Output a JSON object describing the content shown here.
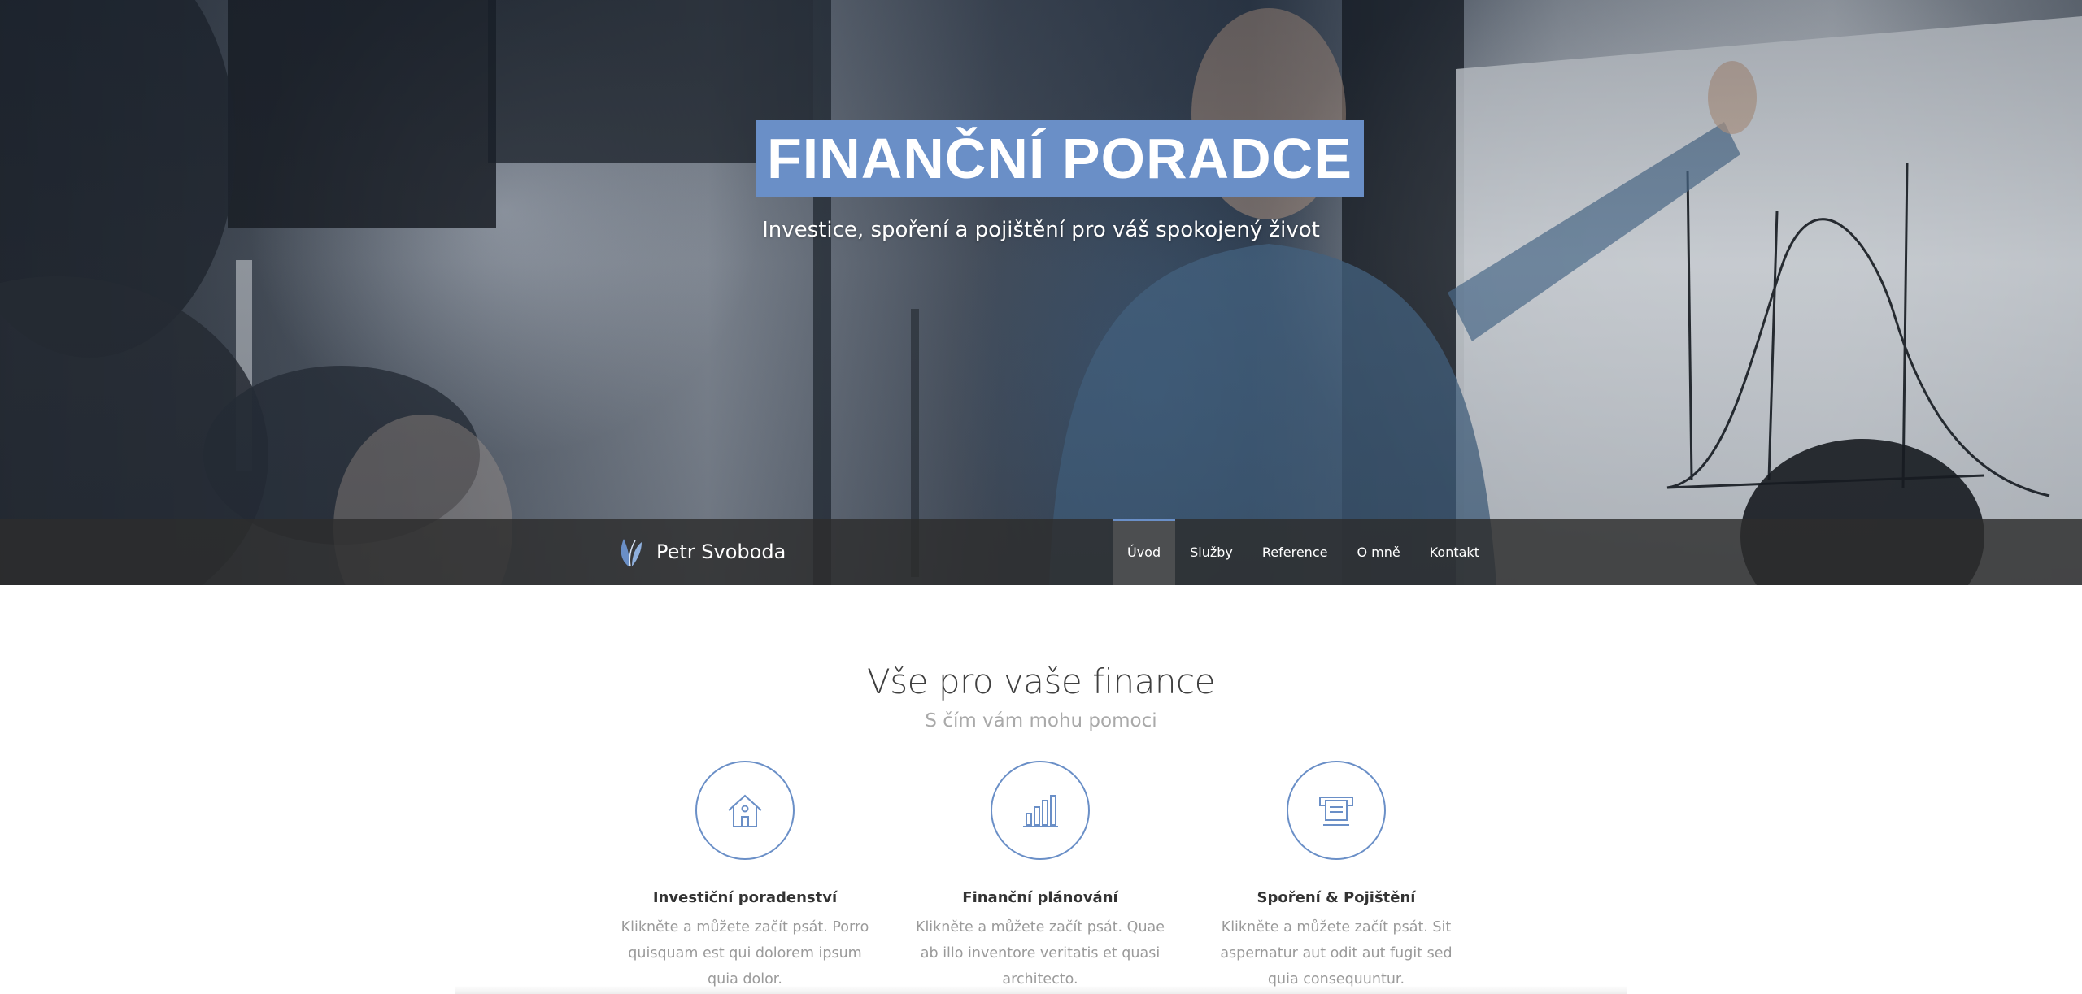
{
  "hero": {
    "title": "FINANČNÍ PORADCE",
    "subtitle": "Investice, spoření a pojištění pro váš spokojený život",
    "title_bg_color": "#6a8fc7"
  },
  "navbar": {
    "brand_name": "Petr Svoboda",
    "logo_icon": "leaf-logo-icon",
    "items": [
      {
        "label": "Úvod",
        "active": true
      },
      {
        "label": "Služby",
        "active": false
      },
      {
        "label": "Reference",
        "active": false
      },
      {
        "label": "O mně",
        "active": false
      },
      {
        "label": "Kontakt",
        "active": false
      }
    ]
  },
  "services": {
    "title": "Vše pro vaše finance",
    "subtitle": "S čím vám mohu pomoci",
    "accent_color": "#6a8fc7",
    "features": [
      {
        "icon": "house-icon",
        "title": "Investiční poradenství",
        "text": "Klikněte a můžete začít psát. Porro quisquam est qui dolorem ipsum quia dolor."
      },
      {
        "icon": "bar-chart-icon",
        "title": "Finanční plánování",
        "text": "Klikněte a můžete začít psát. Quae ab illo inventore veritatis et quasi architecto."
      },
      {
        "icon": "atm-icon",
        "title": "Spoření & Pojištění",
        "text": "Klikněte a můžete začít psát. Sit aspernatur aut odit aut fugit sed quia consequuntur."
      }
    ]
  }
}
